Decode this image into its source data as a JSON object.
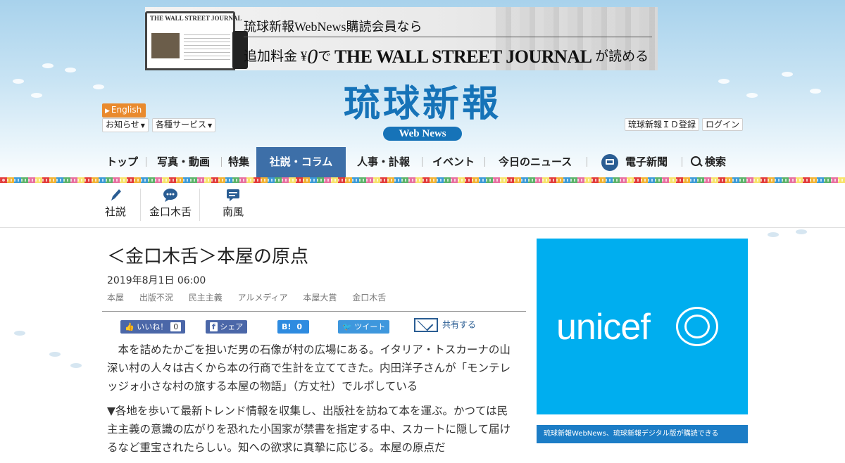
{
  "banner": {
    "laptop_brand": "THE WALL STREET JOURNAL",
    "line1": "琉球新報WebNews購読会員なら",
    "line2_prefix": "追加料金",
    "line2_yen": "¥",
    "line2_zero": "0",
    "line2_de": "で",
    "line2_wsj": "THE WALL STREET JOURNAL",
    "line2_suffix": "が読める"
  },
  "header": {
    "logo_text": "琉球新報",
    "logo_sub": "Web News",
    "english_label": "English",
    "notices_label": "お知らせ",
    "services_label": "各種サービス",
    "register_label": "琉球新報ＩＤ登録",
    "login_label": "ログイン"
  },
  "nav": {
    "top": "トップ",
    "photo_video": "写真・動画",
    "feature": "特集",
    "editorial": "社説・コラム",
    "personnel": "人事・訃報",
    "event": "イベント",
    "today": "今日のニュース",
    "e_paper": "電子新聞",
    "search": "検索"
  },
  "subnav": {
    "editorial": "社説",
    "kinkou": "金口木舌",
    "nanpu": "南風"
  },
  "article": {
    "title": "＜金口木舌＞本屋の原点",
    "date": "2019年8月1日 06:00",
    "tags": [
      "本屋",
      "出版不況",
      "民主主義",
      "アルメディア",
      "本屋大賞",
      "金口木舌"
    ],
    "paragraphs": [
      "本を詰めたかごを担いだ男の石像が村の広場にある。イタリア・トスカーナの山深い村の人々は古くから本の行商で生計を立ててきた。内田洋子さんが「モンテレッジォ小さな村の旅する本屋の物語」（方丈社）でルポしている",
      "▼各地を歩いて最新トレンド情報を収集し、出版社を訪ねて本を運ぶ。かつては民主主義の意識の広がりを恐れた小国家が禁書を指定する中、スカートに隠して届けるなど重宝されたらしい。知への欲求に真摯に応じる。本屋の原点だ"
    ]
  },
  "share": {
    "like_label": "いいね！",
    "like_count": "0",
    "share_label": "シェア",
    "hatena_label": "B!",
    "hatena_count": "0",
    "tweet_label": "ツイート",
    "share_all_label": "共有する"
  },
  "sidebar": {
    "unicef_word": "unicef",
    "ad2_text": "琉球新報WebNews、琉球新報デジタル版が購読できる"
  },
  "colors": {
    "brand_blue": "#1673b8",
    "nav_active": "#3d6fa8",
    "english_orange": "#e98a2d",
    "unicef_blue": "#00aeef"
  }
}
